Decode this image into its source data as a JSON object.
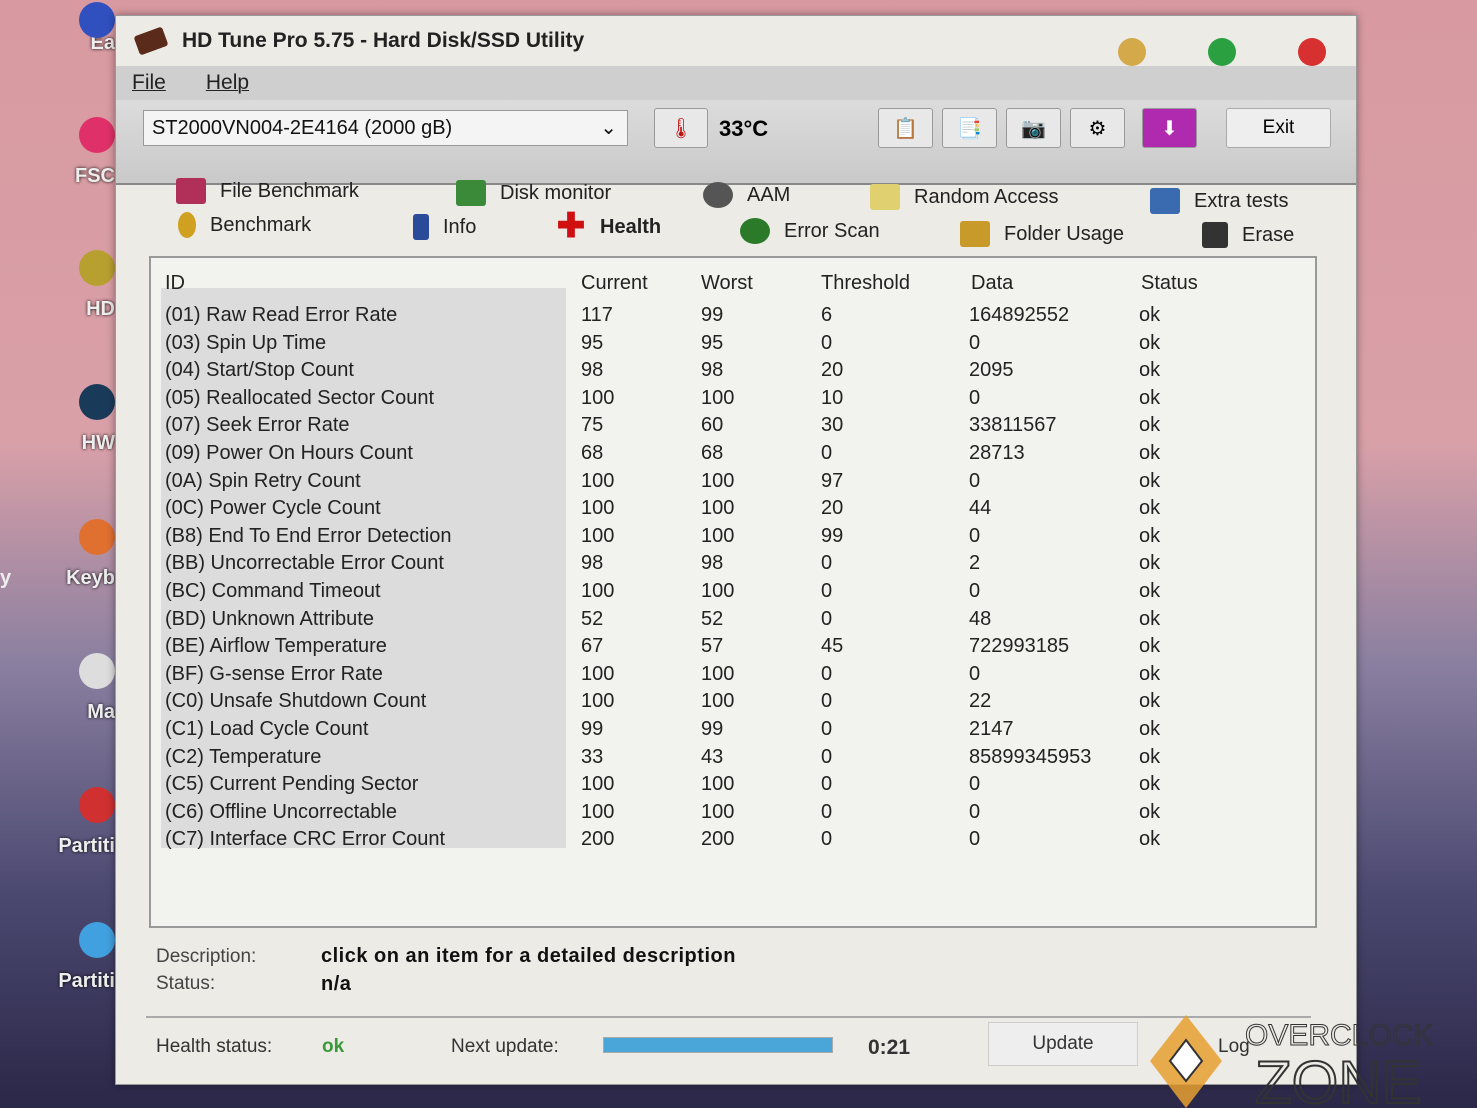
{
  "desktop": {
    "icons": [
      "Ea",
      "FSC",
      "HD",
      "HW",
      "Keyb",
      "Ma",
      "Partiti",
      "Partiti"
    ],
    "edge_text": "y"
  },
  "window": {
    "title": "HD Tune Pro 5.75 - Hard Disk/SSD Utility",
    "dot_colors": [
      "#d4a94a",
      "#2aa040",
      "#d63030"
    ]
  },
  "menu": [
    "File",
    "Help"
  ],
  "toolbar": {
    "drive": "ST2000VN004-2E4164 (2000 gB)",
    "temperature": "33°C",
    "exit": "Exit",
    "buttons": [
      "copy-icon",
      "copy-all-icon",
      "camera-icon",
      "options-icon",
      "save-icon"
    ]
  },
  "tabs": {
    "row1": [
      "File Benchmark",
      "Disk monitor",
      "AAM",
      "Random Access",
      "Extra tests"
    ],
    "row2": [
      "Benchmark",
      "Info",
      "Health",
      "Error Scan",
      "Folder Usage",
      "Erase"
    ],
    "active": "Health"
  },
  "table": {
    "columns": [
      "ID",
      "Current",
      "Worst",
      "Threshold",
      "Data",
      "Status"
    ],
    "rows": [
      [
        "(01) Raw Read Error Rate",
        "117",
        "99",
        "6",
        "164892552",
        "ok"
      ],
      [
        "(03) Spin Up Time",
        "95",
        "95",
        "0",
        "0",
        "ok"
      ],
      [
        "(04) Start/Stop Count",
        "98",
        "98",
        "20",
        "2095",
        "ok"
      ],
      [
        "(05) Reallocated Sector Count",
        "100",
        "100",
        "10",
        "0",
        "ok"
      ],
      [
        "(07) Seek Error Rate",
        "75",
        "60",
        "30",
        "33811567",
        "ok"
      ],
      [
        "(09) Power On Hours Count",
        "68",
        "68",
        "0",
        "28713",
        "ok"
      ],
      [
        "(0A) Spin Retry Count",
        "100",
        "100",
        "97",
        "0",
        "ok"
      ],
      [
        "(0C) Power Cycle Count",
        "100",
        "100",
        "20",
        "44",
        "ok"
      ],
      [
        "(B8) End To End Error Detection",
        "100",
        "100",
        "99",
        "0",
        "ok"
      ],
      [
        "(BB) Uncorrectable Error Count",
        "98",
        "98",
        "0",
        "2",
        "ok"
      ],
      [
        "(BC) Command Timeout",
        "100",
        "100",
        "0",
        "0",
        "ok"
      ],
      [
        "(BD) Unknown Attribute",
        "52",
        "52",
        "0",
        "48",
        "ok"
      ],
      [
        "(BE) Airflow Temperature",
        "67",
        "57",
        "45",
        "722993185",
        "ok"
      ],
      [
        "(BF) G-sense Error Rate",
        "100",
        "100",
        "0",
        "0",
        "ok"
      ],
      [
        "(C0) Unsafe Shutdown Count",
        "100",
        "100",
        "0",
        "22",
        "ok"
      ],
      [
        "(C1) Load Cycle Count",
        "99",
        "99",
        "0",
        "2147",
        "ok"
      ],
      [
        "(C2) Temperature",
        "33",
        "43",
        "0",
        "85899345953",
        "ok"
      ],
      [
        "(C5) Current Pending Sector",
        "100",
        "100",
        "0",
        "0",
        "ok"
      ],
      [
        "(C6) Offline Uncorrectable",
        "100",
        "100",
        "0",
        "0",
        "ok"
      ],
      [
        "(C7) Interface CRC Error Count",
        "200",
        "200",
        "0",
        "0",
        "ok"
      ]
    ]
  },
  "details": {
    "description_label": "Description:",
    "description": "click on an item for a detailed description",
    "status_label": "Status:",
    "status": "n/a"
  },
  "footer": {
    "health_label": "Health status:",
    "health": "ok",
    "health_color": "#3a9a3a",
    "next_update_label": "Next update:",
    "progress": 1.0,
    "countdown": "0:21",
    "update": "Update",
    "log": "Log"
  },
  "watermark": "OVERCLOCK ZONE"
}
